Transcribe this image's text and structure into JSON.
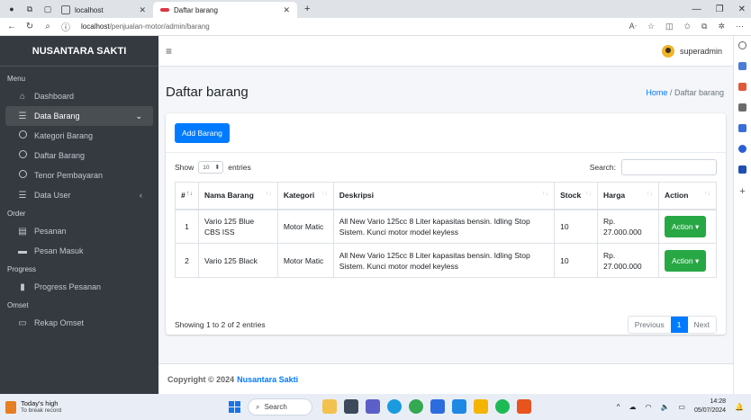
{
  "browser": {
    "tabs": [
      {
        "title": "localhost"
      },
      {
        "title": "Daftar barang"
      }
    ],
    "new_tab": "+",
    "url_host": "localhost",
    "url_path": "/penjualan-motor/admin/barang"
  },
  "sidebar": {
    "brand": "NUSANTARA SAKTI",
    "sections": {
      "menu": "Menu",
      "order": "Order",
      "progress": "Progress",
      "omset": "Omset"
    },
    "items": [
      {
        "label": "Dashboard"
      },
      {
        "label": "Data Barang"
      },
      {
        "label": "Kategori Barang"
      },
      {
        "label": "Daftar Barang"
      },
      {
        "label": "Tenor Pembayaran"
      },
      {
        "label": "Data User"
      },
      {
        "label": "Pesanan"
      },
      {
        "label": "Pesan Masuk"
      },
      {
        "label": "Progress Pesanan"
      },
      {
        "label": "Rekap Omset"
      }
    ]
  },
  "topnav": {
    "user": "superadmin"
  },
  "page": {
    "title": "Daftar barang",
    "breadcrumb_home": "Home",
    "breadcrumb_sep": "/",
    "breadcrumb_current": "Daftar barang"
  },
  "card": {
    "add_button": "Add Barang",
    "show_label": "Show",
    "entries_value": "10",
    "entries_label": "entries",
    "search_label": "Search:"
  },
  "table": {
    "columns": [
      "#",
      "Nama Barang",
      "Kategori",
      "Deskripsi",
      "Stock",
      "Harga",
      "Action"
    ],
    "rows": [
      {
        "no": "1",
        "nama": "Vario 125 Blue CBS ISS",
        "kategori": "Motor Matic",
        "deskripsi": "All New Vario 125cc 8 Liter kapasitas bensin. Idling Stop Sistem. Kunci motor model keyless",
        "stock": "10",
        "harga": "Rp. 27.000.000",
        "action": "Action"
      },
      {
        "no": "2",
        "nama": "Vario 125 Black",
        "kategori": "Motor Matic",
        "deskripsi": "All New Vario 125cc 8 Liter kapasitas bensin. Idling Stop Sistem. Kunci motor model keyless",
        "stock": "10",
        "harga": "Rp. 27.000.000",
        "action": "Action"
      }
    ],
    "info": "Showing 1 to 2 of 2 entries",
    "pager": {
      "previous": "Previous",
      "current": "1",
      "next": "Next"
    }
  },
  "footer": {
    "text": "Copyright © 2024",
    "link": "Nusantara Sakti"
  },
  "taskbar": {
    "weather_title": "Today's high",
    "weather_sub": "To break record",
    "search": "Search",
    "time": "14:28",
    "date": "05/07/2024"
  },
  "colors": {
    "primary": "#007bff",
    "success": "#28a745",
    "sidebar": "#343a40"
  }
}
